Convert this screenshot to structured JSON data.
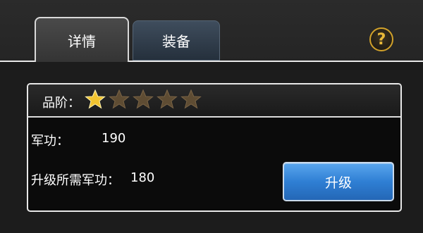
{
  "tabs": [
    {
      "label": "详情",
      "active": true
    },
    {
      "label": "装备",
      "active": false
    }
  ],
  "help_icon": "help-circle-icon",
  "colors": {
    "accent_blue": "#2f7fd4",
    "star_gold": "#f2c430",
    "star_dim": "#5e4c33",
    "help_gold": "#d2a22a"
  },
  "quality": {
    "label": "品阶：",
    "stars_filled": 1,
    "stars_total": 5
  },
  "merit": {
    "label": "军功：",
    "value": "190"
  },
  "required_merit": {
    "label": "升级所需军功：",
    "value": "180"
  },
  "upgrade_button": "升级"
}
